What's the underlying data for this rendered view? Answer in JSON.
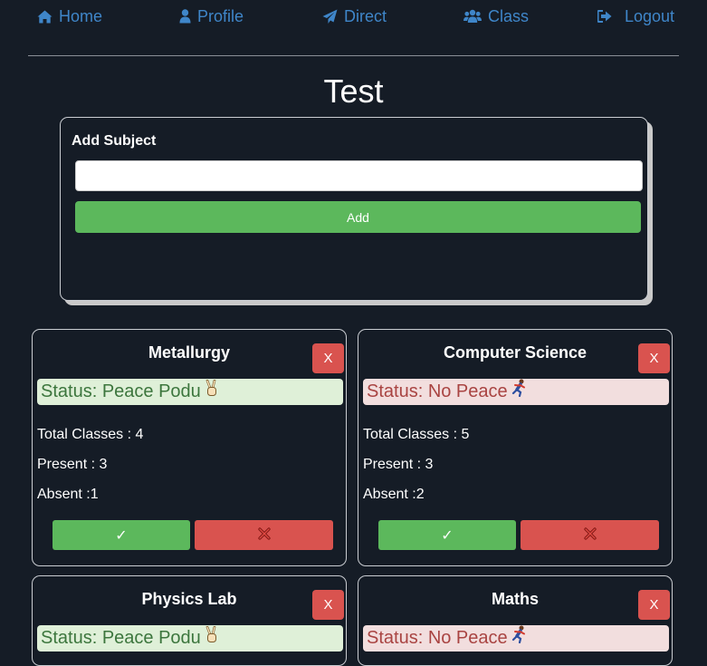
{
  "nav": {
    "home": {
      "label": "Home",
      "icon": "home-icon"
    },
    "profile": {
      "label": "Profile",
      "icon": "user-icon"
    },
    "direct": {
      "label": "Direct",
      "icon": "paper-plane-icon"
    },
    "class": {
      "label": "Class",
      "icon": "users-icon"
    },
    "logout": {
      "label": "Logout",
      "icon": "sign-out-icon"
    }
  },
  "page": {
    "title": "Test"
  },
  "add_subject": {
    "title": "Add Subject",
    "input_value": "",
    "button_label": "Add"
  },
  "subjects": [
    {
      "name": "Metallurgy",
      "delete_label": "X",
      "status": "Status: Peace Podu",
      "status_emoji": "victory-hand-icon",
      "total": "Total Classes : 4",
      "present": "Present : 3",
      "absent": "Absent :1",
      "present_button": "✓",
      "absent_button": "cross-mark-icon"
    },
    {
      "name": "Computer Science",
      "delete_label": "X",
      "status": "Status: No Peace",
      "status_emoji": "running-person-icon",
      "total": "Total Classes : 5",
      "present": "Present : 3",
      "absent": "Absent :2",
      "present_button": "✓",
      "absent_button": "cross-mark-icon"
    },
    {
      "name": "Physics Lab",
      "delete_label": "X",
      "status": "Status: Peace Podu",
      "status_emoji": "victory-hand-icon"
    },
    {
      "name": "Maths",
      "delete_label": "X",
      "status": "Status: No Peace",
      "status_emoji": "running-person-icon"
    }
  ],
  "colors": {
    "background": "#151c26",
    "nav_link": "#3f86c9",
    "success": "#5cb85c",
    "danger": "#d9534f",
    "status_ok_bg": "#dff0d8",
    "status_ok_text": "#3c763d",
    "status_bad_bg": "#f2dede",
    "status_bad_text": "#a94442"
  }
}
